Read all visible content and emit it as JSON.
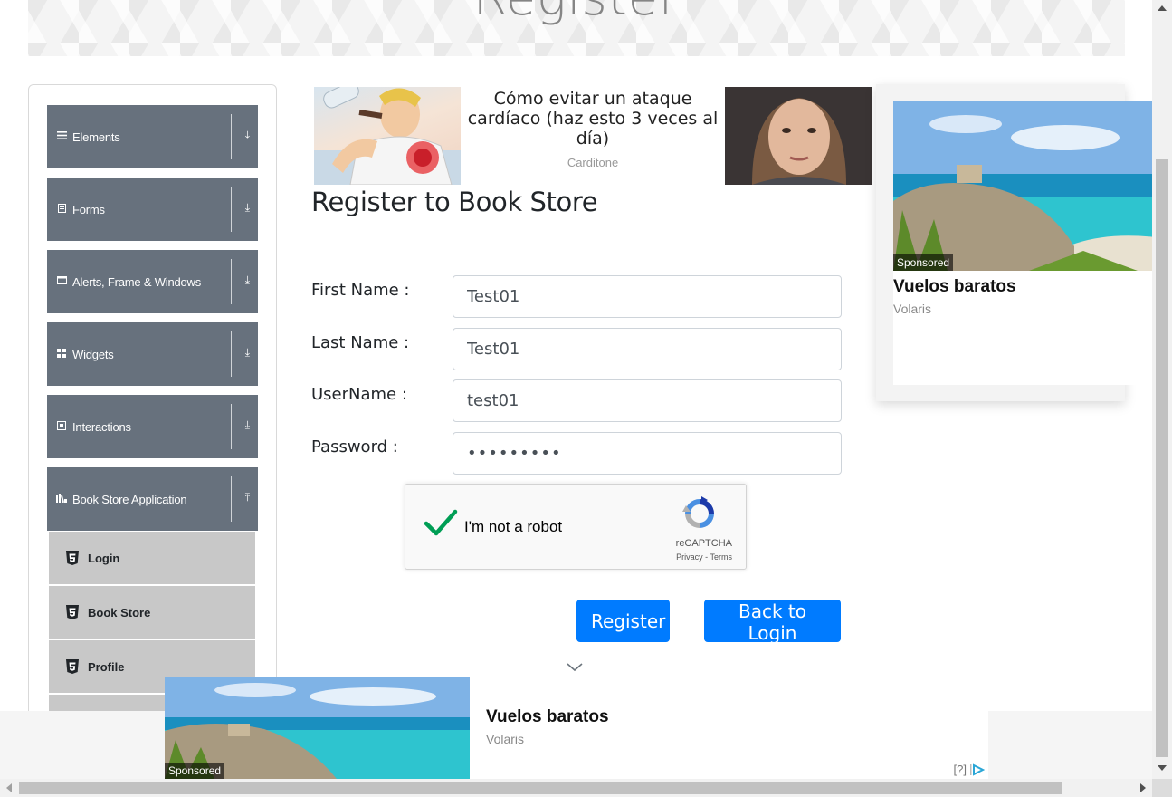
{
  "header": {
    "title": "Register"
  },
  "sidebar": {
    "groups": [
      {
        "label": "Elements",
        "icon": "hamburger-icon",
        "arrow": "⤓"
      },
      {
        "label": "Forms",
        "icon": "document-icon",
        "arrow": "⤓"
      },
      {
        "label": "Alerts, Frame & Windows",
        "icon": "window-icon",
        "arrow": "⤓"
      },
      {
        "label": "Widgets",
        "icon": "grid-icon",
        "arrow": "⤓"
      },
      {
        "label": "Interactions",
        "icon": "cursor-box-icon",
        "arrow": "⤓"
      },
      {
        "label": "Book Store Application",
        "icon": "books-icon",
        "arrow": "⤒"
      }
    ],
    "subitems": [
      {
        "label": "Login",
        "icon": "html5-icon"
      },
      {
        "label": "Book Store",
        "icon": "html5-icon"
      },
      {
        "label": "Profile",
        "icon": "html5-icon"
      }
    ]
  },
  "top_ad": {
    "headline": "Cómo evitar un ataque cardíaco (haz esto 3 veces al día)",
    "source": "Carditone"
  },
  "form": {
    "title": "Register to Book Store",
    "fields": [
      {
        "label": "First Name :",
        "value": "Test01"
      },
      {
        "label": "Last Name :",
        "value": "Test01"
      },
      {
        "label": "UserName :",
        "value": "test01"
      },
      {
        "label": "Password :",
        "value": "•••••••••"
      }
    ],
    "captcha": {
      "label": "I'm not a robot",
      "brand": "reCAPTCHA",
      "links": "Privacy - Terms",
      "checked": true
    },
    "register_button": "Register",
    "back_button": "Back to Login"
  },
  "right_ad": {
    "badge": "Sponsored",
    "title": "Vuelos baratos",
    "source": "Volaris"
  },
  "bottom_ad": {
    "badge": "Sponsored",
    "title": "Vuelos baratos",
    "source": "Volaris",
    "help": "[?]"
  },
  "colors": {
    "sidebar_group": "#67717d",
    "sidebar_subitem": "#c8c8c8",
    "primary": "#007bff",
    "captcha_check": "#009e55"
  }
}
